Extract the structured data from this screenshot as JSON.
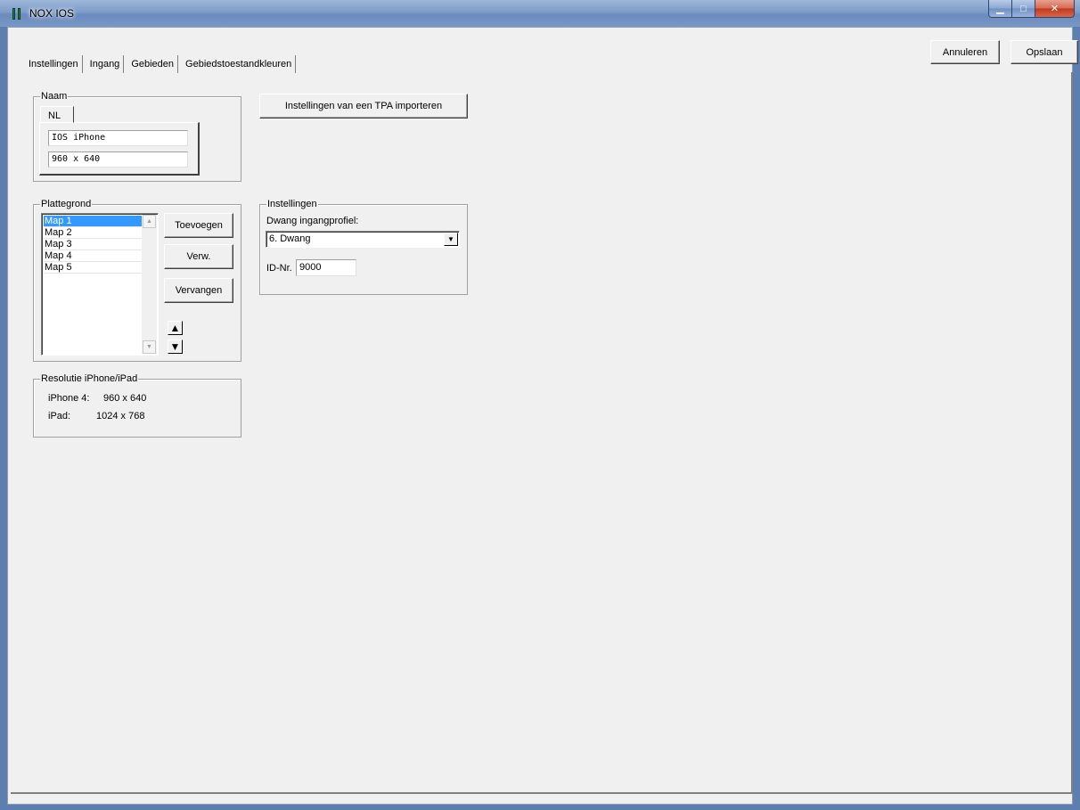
{
  "window": {
    "title": "NOX IOS",
    "title_color": "#000000",
    "minimize_icon": "minimize-icon",
    "maximize_icon": "maximize-icon",
    "close_icon": "close-icon"
  },
  "header": {
    "cancel_label": "Annuleren",
    "save_label": "Opslaan"
  },
  "tabs": [
    {
      "label": "Instellingen"
    },
    {
      "label": "Ingang"
    },
    {
      "label": "Gebieden"
    },
    {
      "label": "Gebiedstoestandkleuren"
    }
  ],
  "naam": {
    "legend": "Naam",
    "lang_tab": "NL",
    "line1": "IOS iPhone",
    "line2": "960 x 640"
  },
  "import_button": "Instellingen van een TPA importeren",
  "plattegrond": {
    "legend": "Plattegrond",
    "items": [
      "Map 1",
      "Map 2",
      "Map 3",
      "Map 4",
      "Map 5"
    ],
    "selected": "Map 1",
    "add_label": "Toevoegen",
    "remove_label": "Verw.",
    "replace_label": "Vervangen"
  },
  "resolutie": {
    "legend": "Resolutie iPhone/iPad",
    "rows": [
      {
        "device": "iPhone 4:",
        "value": "960 x 640"
      },
      {
        "device": "iPad:",
        "value": "1024 x 768"
      }
    ]
  },
  "instellingen": {
    "legend": "Instellingen",
    "dwang_label": "Dwang ingangprofiel:",
    "dwang_value": "6. Dwang",
    "id_label": "ID-Nr.",
    "id_value": "9000"
  },
  "colors": {
    "selection": "#3399ff",
    "background": "#f0f0f0",
    "titlebar": "#7e9cc8"
  }
}
